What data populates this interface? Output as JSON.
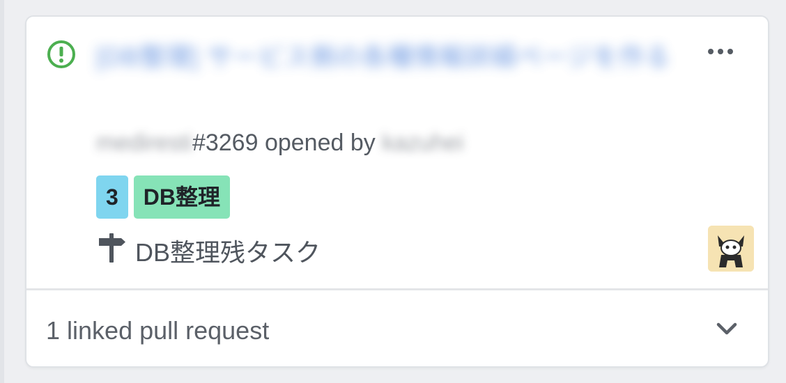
{
  "card": {
    "title": "[DB整理] サービス側の各種情報詳細ページを作る",
    "repo": "mediresti",
    "issue_number": "#3269",
    "opened_by_text": "opened by",
    "author": "kazuhei",
    "status_icon": "issue-open-icon",
    "more_icon": "kebab-horizontal-icon",
    "labels": [
      {
        "text": "3",
        "color": "#7fd5ef"
      },
      {
        "text": "DB整理",
        "color": "#86e3b7"
      }
    ],
    "milestone_icon": "milestone-icon",
    "milestone": "DB整理残タスク",
    "avatar_icon": "user-avatar-icon",
    "footer_text": "1 linked pull request",
    "footer_icon": "chevron-down-icon",
    "colors": {
      "open_green": "#4caf50",
      "title_blue": "#3f78d8",
      "muted_text": "#555b63"
    }
  }
}
